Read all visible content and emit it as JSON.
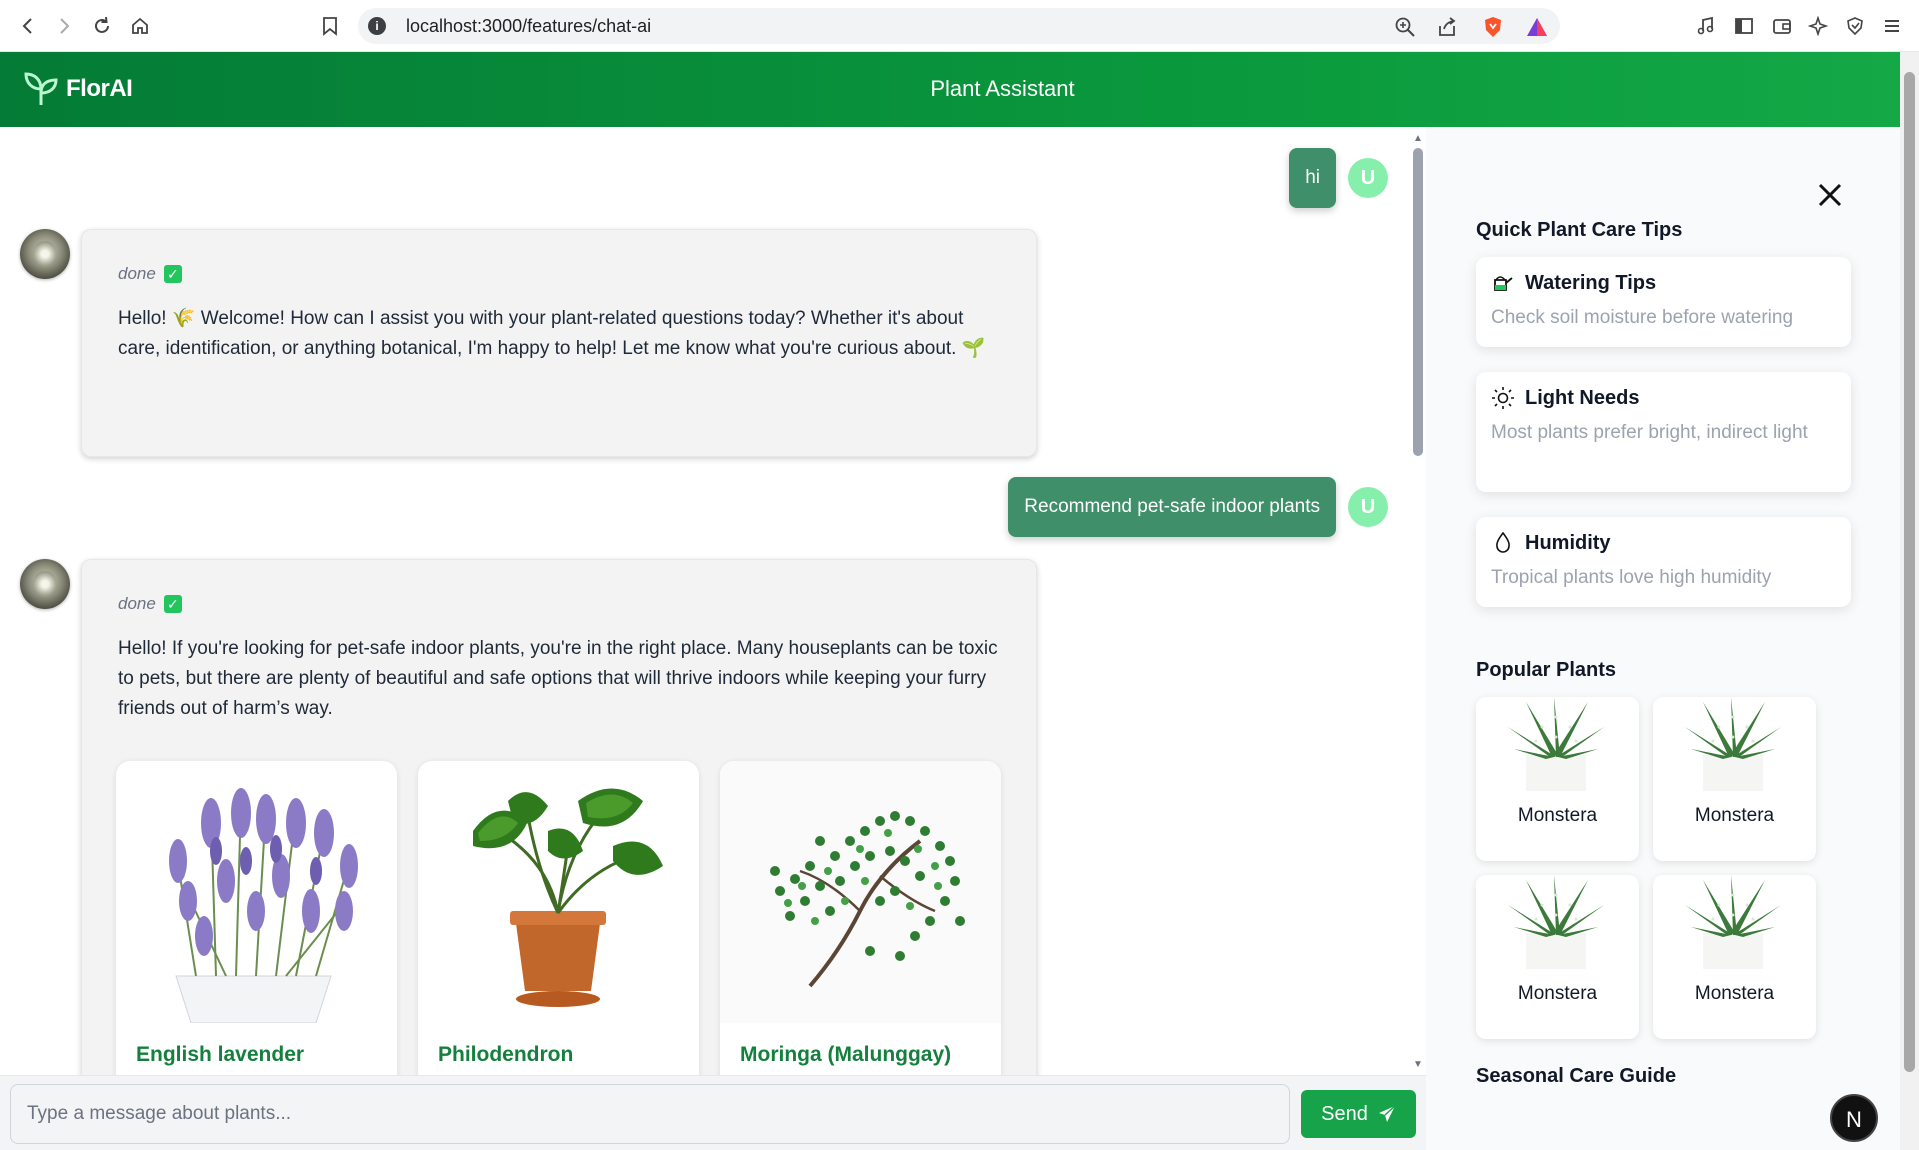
{
  "browser": {
    "url": "localhost:3000/features/chat-ai",
    "url_info_glyph": "i"
  },
  "header": {
    "brand": "FlorAI",
    "title": "Plant Assistant"
  },
  "chat": {
    "messages": [
      {
        "role": "user",
        "text": "hi",
        "avatar": "U"
      },
      {
        "role": "bot",
        "status": "done",
        "status_icon": "✓",
        "text": "Hello! 🌾 Welcome! How can I assist you with your plant-related questions today? Whether it's about care, identification, or anything botanical, I'm happy to help! Let me know what you're curious about. 🌱"
      },
      {
        "role": "user",
        "text": "Recommend pet-safe indoor plants",
        "avatar": "U"
      },
      {
        "role": "bot",
        "status": "done",
        "status_icon": "✓",
        "text": "Hello! If you're looking for pet-safe indoor plants, you're in the right place. Many houseplants can be toxic to pets, but there are plenty of beautiful and safe options that will thrive indoors while keeping your furry friends out of harm’s way."
      }
    ],
    "plant_cards": [
      {
        "name": "English lavender",
        "image": "lavender-image"
      },
      {
        "name": "Philodendron",
        "image": "philodendron-image"
      },
      {
        "name": "Moringa (Malunggay)",
        "image": "moringa-image"
      }
    ]
  },
  "input": {
    "placeholder": "Type a message about plants...",
    "value": "",
    "send_label": "Send"
  },
  "sidebar": {
    "tips_title": "Quick Plant Care Tips",
    "tips": [
      {
        "title": "Watering Tips",
        "desc": "Check soil moisture before watering",
        "icon": "watering-can-icon"
      },
      {
        "title": "Light Needs",
        "desc": "Most plants prefer bright, indirect light",
        "icon": "sun-icon"
      },
      {
        "title": "Humidity",
        "desc": "Tropical plants love high humidity",
        "icon": "droplet-icon"
      }
    ],
    "popular_title": "Popular Plants",
    "popular": [
      {
        "name": "Monstera"
      },
      {
        "name": "Monstera"
      },
      {
        "name": "Monstera"
      },
      {
        "name": "Monstera"
      }
    ],
    "seasonal_title": "Seasonal Care Guide"
  },
  "badge": {
    "letter": "N"
  },
  "colors": {
    "header_start": "#047b36",
    "header_end": "#14a847",
    "user_bubble": "#3f8f6a",
    "user_avatar": "#86efac",
    "send_button": "#16a34a",
    "plant_name": "#15803d"
  }
}
